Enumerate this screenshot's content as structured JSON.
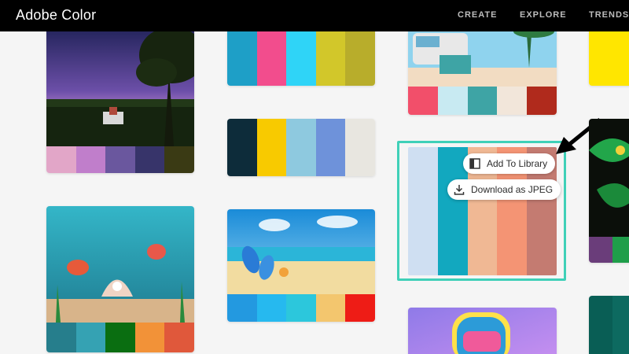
{
  "app": {
    "title": "Adobe Color"
  },
  "nav": {
    "create": "CREATE",
    "explore": "EXPLORE",
    "trends": "TRENDS"
  },
  "actions": {
    "add_to_library": "Add To Library",
    "download_jpeg": "Download as JPEG"
  },
  "palettes": {
    "night_meadow": [
      "#e2a6c8",
      "#c07ecb",
      "#6a579e",
      "#37346a",
      "#3a3a14"
    ],
    "palette_a": [
      "#1e9fc7",
      "#f24d8d",
      "#2fd4f7",
      "#d2c72a",
      "#b8ad2b"
    ],
    "beach_van": [
      "#f24f6a",
      "#c8eaf2",
      "#3ea4a5",
      "#f2e6da",
      "#b02a1c"
    ],
    "yellow_partial": [
      "#ffe600"
    ],
    "palette_b": [
      "#0d2c3a",
      "#f8ca00",
      "#8ec9df",
      "#6e92da",
      "#e8e6e0"
    ],
    "selected_palette": [
      "#cfdff2",
      "#12a8bf",
      "#f0b894",
      "#f49474",
      "#c47b71"
    ],
    "green_partial": [
      "#6a3d7a",
      "#1f9e4a"
    ],
    "underwater": [
      "#267e8c",
      "#35a2b3",
      "#0a6e11",
      "#f29238",
      "#e0583b"
    ],
    "beach_flipflops": [
      "#2399e0",
      "#26b9ef",
      "#2cc7dc",
      "#f3c66e",
      "#ee1c16"
    ],
    "teal_partial": [
      "#095e55",
      "#0d6a60"
    ]
  },
  "colors": {
    "accent": "#3fd0b8",
    "topbar": "#000000"
  }
}
